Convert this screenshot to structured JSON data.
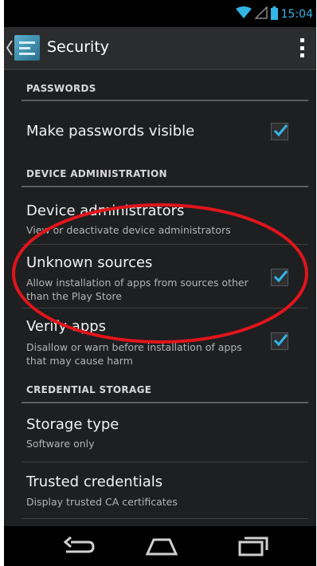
{
  "status_bar": {
    "time": "15:04",
    "icons": [
      "wifi-icon",
      "signal-icon",
      "battery-icon"
    ],
    "time_color": "#33b5e5"
  },
  "action_bar": {
    "title": "Security",
    "icons": [
      "back-caret-icon",
      "security-app-icon",
      "overflow-menu-icon"
    ]
  },
  "sections": [
    {
      "header": "PASSWORDS",
      "items": [
        {
          "title": "Make passwords visible",
          "summary": "",
          "checked": true
        }
      ]
    },
    {
      "header": "DEVICE ADMINISTRATION",
      "items": [
        {
          "title": "Device administrators",
          "summary": "View or deactivate device administrators"
        },
        {
          "title": "Unknown sources",
          "summary": "Allow installation of apps from sources other than the Play Store",
          "checked": true
        },
        {
          "title": "Verify apps",
          "summary": "Disallow or warn before installation of apps that may cause harm",
          "checked": true
        }
      ]
    },
    {
      "header": "CREDENTIAL STORAGE",
      "items": [
        {
          "title": "Storage type",
          "summary": "Software only"
        },
        {
          "title": "Trusted credentials",
          "summary": "Display trusted CA certificates"
        }
      ]
    }
  ],
  "navigation_bar": {
    "buttons": [
      "back-icon",
      "home-icon",
      "recent-apps-icon"
    ]
  },
  "colors": {
    "accent": "#33b5e5",
    "annotation": "#e0151b",
    "background": "#1e1f21"
  }
}
